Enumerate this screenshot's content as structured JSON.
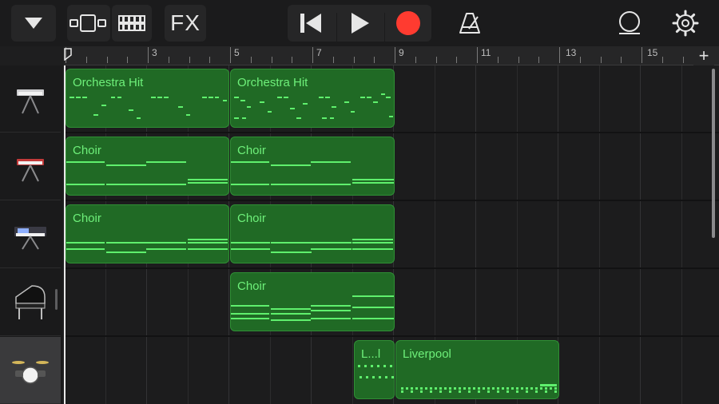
{
  "toolbar": {
    "fx_label": "FX",
    "icons": [
      "dropdown-triangle-icon",
      "view-toggle-icon",
      "mixer-icon",
      "rewind-icon",
      "play-icon",
      "record-icon",
      "metronome-icon",
      "loop-icon",
      "settings-gear-icon"
    ],
    "record_color": "#ff3b30"
  },
  "ruler": {
    "numbers": [
      "3",
      "5",
      "7",
      "9",
      "11",
      "13",
      "15"
    ],
    "add_label": "+"
  },
  "tracks": [
    {
      "instrument": "keyboard-synth"
    },
    {
      "instrument": "red-synth"
    },
    {
      "instrument": "workstation-synth"
    },
    {
      "instrument": "grand-piano"
    },
    {
      "instrument": "drum-kit"
    }
  ],
  "regions": [
    {
      "title": "Orchestra Hit"
    },
    {
      "title": "Orchestra Hit"
    },
    {
      "title": "Choir"
    },
    {
      "title": "Choir"
    },
    {
      "title": "Choir"
    },
    {
      "title": "Choir"
    },
    {
      "title": "Choir"
    },
    {
      "title": "L...l"
    },
    {
      "title": "Liverpool"
    }
  ],
  "colors": {
    "region_fill": "#206a25",
    "note": "#5ff06d",
    "text": "#6ef07a"
  }
}
